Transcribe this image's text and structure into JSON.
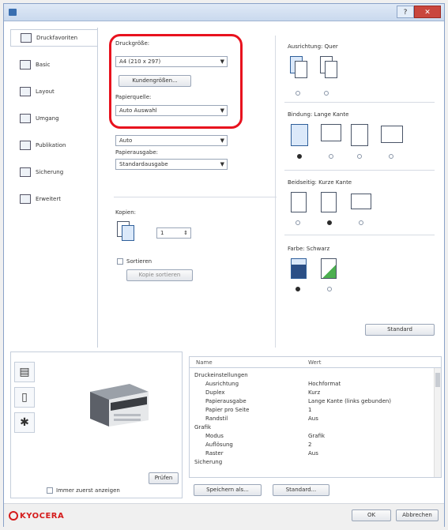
{
  "window": {
    "title": "",
    "help": "?",
    "close": "✕"
  },
  "sidebar": {
    "items": [
      {
        "label": "Druckfavoriten",
        "active": true
      },
      {
        "label": "Basic",
        "active": false
      },
      {
        "label": "Layout",
        "active": false
      },
      {
        "label": "Umgang",
        "active": false
      },
      {
        "label": "Publikation",
        "active": false
      },
      {
        "label": "Sicherung",
        "active": false
      },
      {
        "label": "Erweitert",
        "active": false
      }
    ]
  },
  "main": {
    "paper_size_label": "Druckgröße:",
    "paper_size_value": "A4 (210 x 297)",
    "custom_size_button": "Kundengrößen...",
    "paper_source_label": "Papierquelle:",
    "paper_source_value": "Auto Auswahl",
    "media_type_value": "Auto",
    "destination_label": "Papierausgabe:",
    "destination_value": "Standardausgabe",
    "copies_label": "Kopien:",
    "copies_value": "1",
    "collate_label": "Sortieren",
    "collate_button": "Kopie sortieren",
    "orientation_label": "Ausrichtung: Quer",
    "duplex_label": "Bindung: Lange Kante",
    "binding_label": "Beidseitig: Kurze Kante",
    "color_label": "Farbe: Schwarz",
    "reset_button": "Standard"
  },
  "preview": {
    "tools": [
      "print-settings-icon",
      "page-icon",
      "gear-icon"
    ],
    "preview_button": "Prüfen"
  },
  "summary": {
    "col_name": "Name",
    "col_value": "Wert",
    "rows": [
      {
        "k": "Druckeinstellungen",
        "v": "",
        "indent": 0
      },
      {
        "k": "Ausrichtung",
        "v": "Hochformat",
        "indent": 1
      },
      {
        "k": "Duplex",
        "v": "Kurz",
        "indent": 1
      },
      {
        "k": "Papierausgabe",
        "v": "Lange Kante (links gebunden)",
        "indent": 1
      },
      {
        "k": "Papier pro Seite",
        "v": "1",
        "indent": 1
      },
      {
        "k": "Randstil",
        "v": "Aus",
        "indent": 1
      },
      {
        "k": "Grafik",
        "v": "",
        "indent": 0
      },
      {
        "k": "Modus",
        "v": "Grafik",
        "indent": 1
      },
      {
        "k": "Auflösung",
        "v": "2",
        "indent": 1
      },
      {
        "k": "Raster",
        "v": "Aus",
        "indent": 1
      },
      {
        "k": "Sicherung",
        "v": "",
        "indent": 0
      }
    ]
  },
  "bottom_buttons": {
    "save_as": "Speichern als...",
    "defaults": "Standard..."
  },
  "footer": {
    "show_always_label": "Immer zuerst anzeigen",
    "brand": "KYOCERA",
    "ok": "OK",
    "cancel": "Abbrechen"
  },
  "colors": {
    "highlight": "#e8121e",
    "brand": "#d51c1c",
    "selected_paper": "#dbe9fa"
  }
}
